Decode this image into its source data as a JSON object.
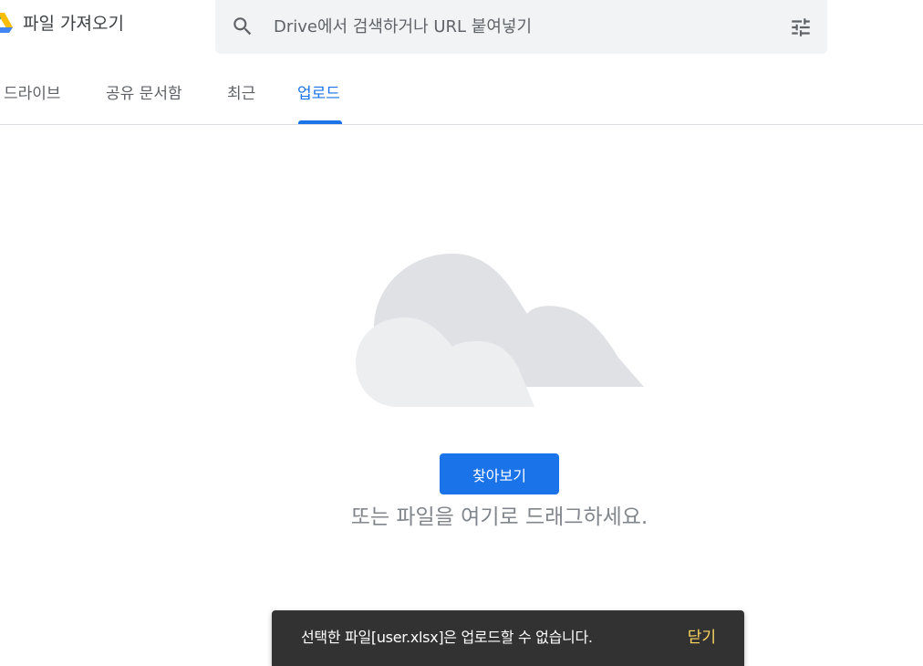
{
  "header": {
    "logo_icon": "google-drive-logo-icon",
    "title": "파일 가져오기"
  },
  "search": {
    "search_icon": "search-icon",
    "placeholder": "Drive에서 검색하거나 URL 붙여넣기",
    "filter_icon": "tune-filter-icon"
  },
  "tabs": [
    {
      "label": "드라이브",
      "active": false
    },
    {
      "label": "공유 문서함",
      "active": false
    },
    {
      "label": "최근",
      "active": false
    },
    {
      "label": "업로드",
      "active": true
    }
  ],
  "upload": {
    "illustration": "cloud-illustration",
    "browse_label": "찾아보기",
    "drag_text": "또는 파일을 여기로 드래그하세요."
  },
  "snackbar": {
    "message": "선택한 파일[user.xlsx]은 업로드할 수 없습니다.",
    "close_label": "닫기"
  },
  "colors": {
    "accent": "#1a73e8",
    "snackbar_bg": "#323232",
    "snackbar_action": "#fdd663",
    "search_bg": "#f1f3f4"
  }
}
